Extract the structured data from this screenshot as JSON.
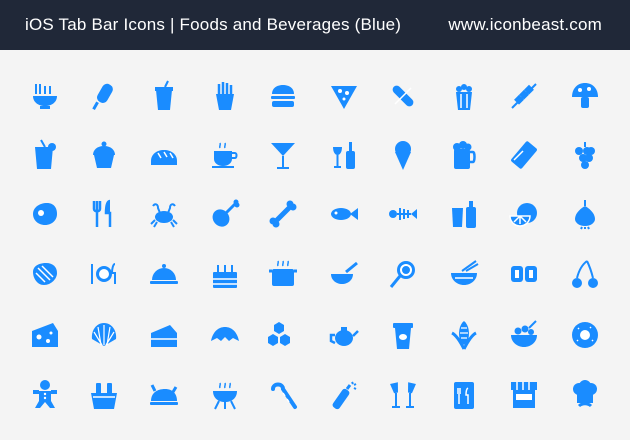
{
  "header": {
    "title": "iOS Tab Bar Icons | Foods and Beverages (Blue)",
    "site": "www.iconbeast.com"
  },
  "colors": {
    "header_bg": "#202838",
    "icon_blue": "#1a8cff",
    "background": "#f4f4f4"
  },
  "icons": [
    [
      "noodle-bowl",
      "popsicle",
      "soda-cup",
      "french-fries",
      "burger",
      "pizza-slice",
      "hot-dog",
      "popcorn",
      "kebab-skewer",
      "mushroom"
    ],
    [
      "cocktail-glass",
      "cupcake",
      "bread-loaf",
      "coffee-cup",
      "martini",
      "wine-bottle",
      "ice-cream-cone",
      "beer-mug",
      "candy-bar",
      "grapes"
    ],
    [
      "steak",
      "fork-knife",
      "crab",
      "chicken-leg",
      "bone",
      "fish",
      "fish-bone",
      "drinks",
      "citrus-fruit",
      "onion"
    ],
    [
      "meat-slab",
      "plate-cutlery",
      "cloche",
      "birthday-cake",
      "pot",
      "bowl-spoon",
      "lollipop",
      "ramen",
      "sushi-roll",
      "cherries"
    ],
    [
      "cheese",
      "shell",
      "cake-slice",
      "croissant",
      "honeycomb",
      "teapot",
      "coffee-cup-togo",
      "corn",
      "salad",
      "donut"
    ],
    [
      "gingerbread-man",
      "beer-bucket",
      "roast-turkey",
      "barbecue-grill",
      "candy-cane",
      "champagne-bottle",
      "toast-glasses",
      "menu",
      "food-stand",
      "chef-hat"
    ]
  ]
}
